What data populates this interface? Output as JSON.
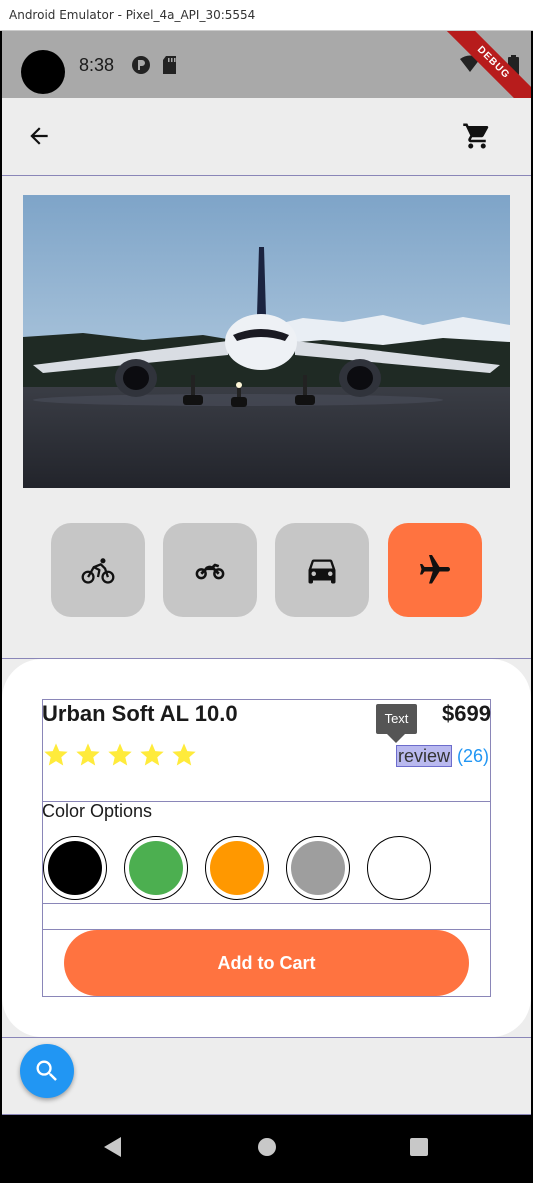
{
  "window": {
    "title": "Android Emulator - Pixel_4a_API_30:5554"
  },
  "status_bar": {
    "time": "8:38",
    "debug_banner": "DEBUG"
  },
  "vehicles": [
    {
      "icon": "bicycle-icon",
      "selected": false
    },
    {
      "icon": "motorcycle-icon",
      "selected": false
    },
    {
      "icon": "car-icon",
      "selected": false
    },
    {
      "icon": "airplane-icon",
      "selected": true
    }
  ],
  "product": {
    "name": "Urban Soft AL 10.0",
    "price": "$699",
    "rating": 5,
    "tooltip": "Text",
    "review_label": "review",
    "review_count": "(26)"
  },
  "color_options": {
    "title": "Color Options",
    "colors": [
      "#000000",
      "#4caf50",
      "#ff9800",
      "#9e9e9e",
      "#ffffff"
    ]
  },
  "actions": {
    "add_to_cart": "Add to Cart"
  },
  "theme": {
    "accent": "#ff7340",
    "fab": "#2196f3",
    "star": "#ffeb3b"
  }
}
